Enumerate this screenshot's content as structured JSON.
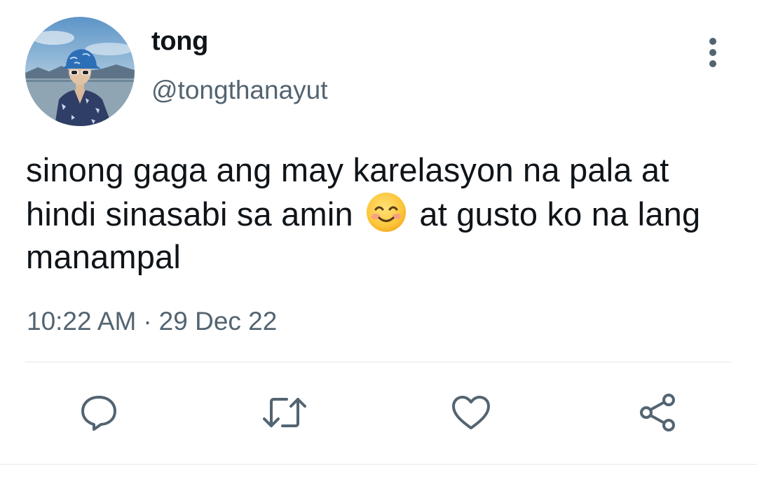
{
  "author": {
    "display_name": "tong",
    "handle": "@tongthanayut"
  },
  "tweet": {
    "text_part1": "sinong gaga ang may karelasyon na pala at hindi sinasabi sa amin",
    "emoji": "smiling-face-with-smiling-eyes",
    "text_part2": "at gusto ko na lang manampal",
    "time": "10:22 AM",
    "separator": "·",
    "date": "29 Dec 22"
  },
  "actions": [
    "reply-icon",
    "retweet-icon",
    "like-icon",
    "share-icon"
  ],
  "colors": {
    "text": "#0f1419",
    "secondary": "#536471",
    "divider": "#eff3f4"
  }
}
